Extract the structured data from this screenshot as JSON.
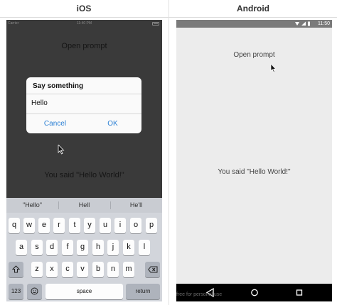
{
  "headers": {
    "ios": "iOS",
    "android": "Android"
  },
  "ios": {
    "status": {
      "carrier": "Carrier",
      "time": "11:40 PM"
    },
    "open_prompt": "Open prompt",
    "said": "You said \"Hello World!\"",
    "alert": {
      "title": "Say something",
      "input_value": "Hello",
      "cancel": "Cancel",
      "ok": "OK"
    },
    "keyboard": {
      "suggestions": [
        "\"Hello\"",
        "Hell",
        "He'll"
      ],
      "row1": [
        "q",
        "w",
        "e",
        "r",
        "t",
        "y",
        "u",
        "i",
        "o",
        "p"
      ],
      "row2": [
        "a",
        "s",
        "d",
        "f",
        "g",
        "h",
        "j",
        "k",
        "l"
      ],
      "row3": [
        "z",
        "x",
        "c",
        "v",
        "b",
        "n",
        "m"
      ],
      "num": "123",
      "space": "space",
      "return": "return"
    }
  },
  "android": {
    "status": {
      "time": "11:50"
    },
    "open_prompt": "Open prompt",
    "said": "You said \"Hello World!\"",
    "watermark": "free for personal use"
  },
  "colors": {
    "ios_bg": "#3a3a3a",
    "ios_accent": "#2a7fd4",
    "android_bg": "#ececec"
  },
  "icons": [
    "shift-icon",
    "backspace-icon",
    "emoji-icon",
    "back-icon",
    "home-icon",
    "recents-icon",
    "wifi-icon",
    "signal-icon",
    "battery-icon",
    "cursor-icon"
  ]
}
